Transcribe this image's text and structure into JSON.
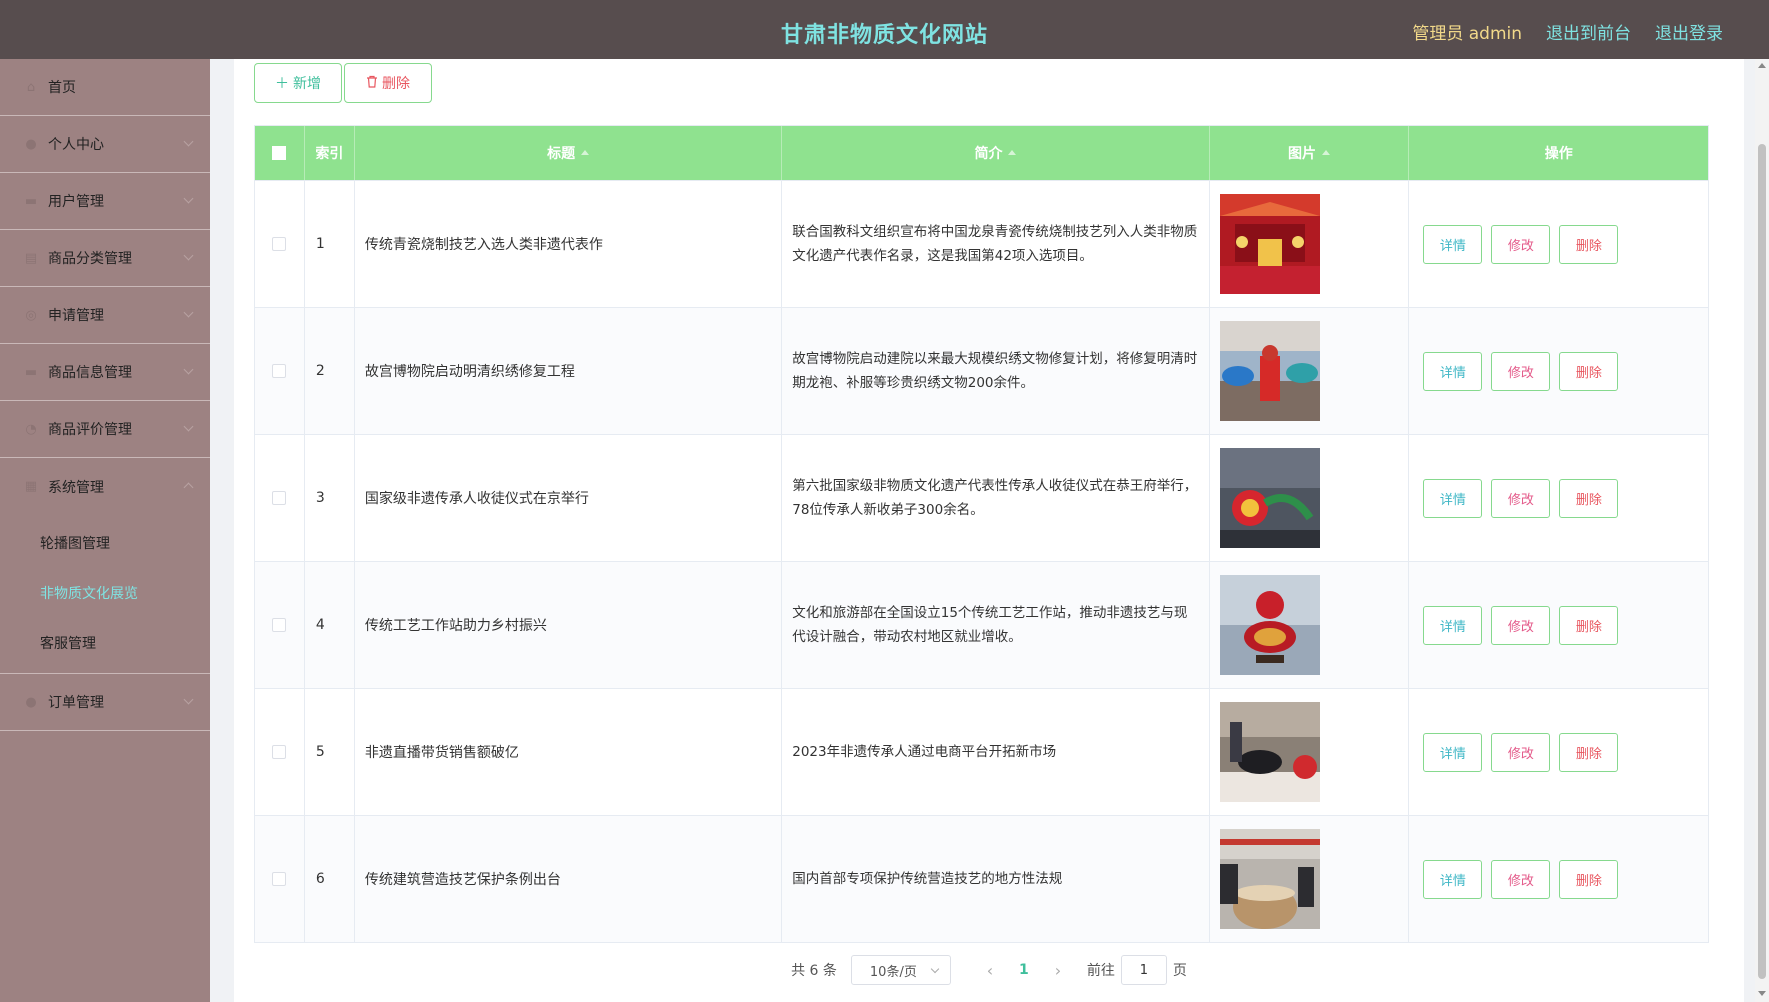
{
  "header": {
    "title": "甘肃非物质文化网站",
    "admin_label": "管理员 admin",
    "back_front": "退出到前台",
    "logout": "退出登录"
  },
  "sidebar": {
    "items": [
      {
        "label": "首页",
        "icon": "home-icon"
      },
      {
        "label": "个人中心",
        "icon": "user-icon"
      },
      {
        "label": "用户管理",
        "icon": "users-icon"
      },
      {
        "label": "商品分类管理",
        "icon": "category-icon"
      },
      {
        "label": "申请管理",
        "icon": "apply-icon"
      },
      {
        "label": "商品信息管理",
        "icon": "goods-icon"
      },
      {
        "label": "商品评价管理",
        "icon": "review-icon"
      },
      {
        "label": "系统管理",
        "icon": "system-icon"
      }
    ],
    "system_sub": [
      "轮播图管理",
      "非物质文化展览",
      "客服管理"
    ],
    "order": {
      "label": "订单管理",
      "icon": "order-icon"
    }
  },
  "toolbar": {
    "add_label": "新增",
    "delete_label": "删除"
  },
  "table": {
    "columns": [
      "索引",
      "标题",
      "简介",
      "图片",
      "操作"
    ],
    "rows": [
      {
        "index": "1",
        "title": "传统青瓷烧制技艺入选人类非遗代表作",
        "summary": "联合国教科文组织宣布将中国龙泉青瓷传统烧制技艺列入人类非物质文化遗产代表作名录，这是我国第42项入选项目。"
      },
      {
        "index": "2",
        "title": "故宫博物院启动明清织绣修复工程",
        "summary": "故宫博物院启动建院以来最大规模织绣文物修复计划，将修复明清时期龙袍、补服等珍贵织绣文物200余件。"
      },
      {
        "index": "3",
        "title": "国家级非遗传承人收徒仪式在京举行",
        "summary": "第六批国家级非物质文化遗产代表性传承人收徒仪式在恭王府举行，78位传承人新收弟子300余名。"
      },
      {
        "index": "4",
        "title": "传统工艺工作站助力乡村振兴",
        "summary": "文化和旅游部在全国设立15个传统工艺工作站，推动非遗技艺与现代设计融合，带动农村地区就业增收。"
      },
      {
        "index": "5",
        "title": "非遗直播带货销售额破亿",
        "summary": "2023年非遗传承人通过电商平台开拓新市场"
      },
      {
        "index": "6",
        "title": "传统建筑营造技艺保护条例出台",
        "summary": "国内首部专项保护传统营造技艺的地方性法规"
      }
    ],
    "actions": {
      "detail": "详情",
      "edit": "修改",
      "remove": "删除"
    }
  },
  "pagination": {
    "total": "共 6 条",
    "page_size": "10条/页",
    "current_page": "1",
    "goto_prefix": "前往",
    "goto_value": "1",
    "goto_suffix": "页"
  },
  "colors": {
    "header_bg": "#574d4e",
    "title_color": "#7fe3e2",
    "sidebar_bg": "#9d8282",
    "table_header_bg": "#8fe28f",
    "accent_border": "#86d98e"
  }
}
